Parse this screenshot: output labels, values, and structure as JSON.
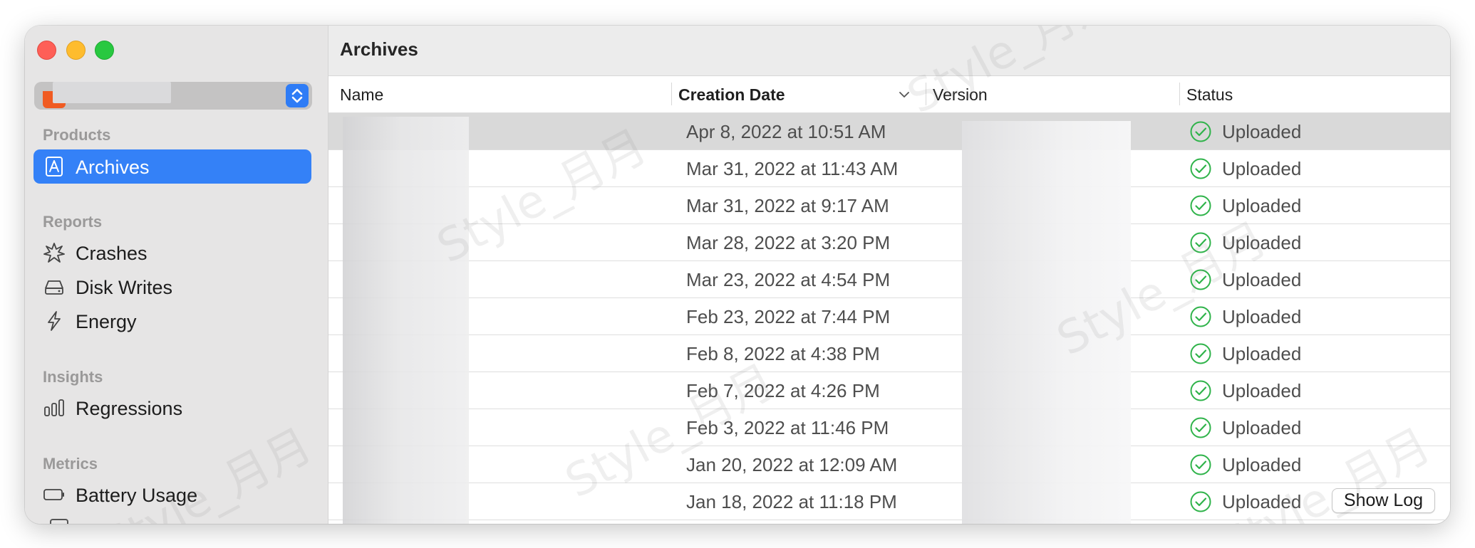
{
  "window": {
    "traffic_lights": {
      "close_color": "#fe5f57",
      "minimize_color": "#febc2e",
      "zoom_color": "#28c840"
    }
  },
  "sidebar": {
    "app_picker": {
      "icon": "app-icon",
      "accent_color": "#2e7cf6"
    },
    "sections": [
      {
        "label": "Products",
        "items": [
          {
            "label": "Archives",
            "icon": "archive-box-icon",
            "selected": true
          }
        ]
      },
      {
        "label": "Reports",
        "items": [
          {
            "label": "Crashes",
            "icon": "crash-burst-icon"
          },
          {
            "label": "Disk Writes",
            "icon": "disk-drive-icon"
          },
          {
            "label": "Energy",
            "icon": "lightning-bolt-icon"
          }
        ]
      },
      {
        "label": "Insights",
        "items": [
          {
            "label": "Regressions",
            "icon": "bar-graph-icon"
          }
        ]
      },
      {
        "label": "Metrics",
        "items": [
          {
            "label": "Battery Usage",
            "icon": "battery-icon"
          }
        ]
      }
    ],
    "selection_color": "#3481f7"
  },
  "main": {
    "title": "Archives",
    "columns": [
      {
        "label": "Name"
      },
      {
        "label": "Creation Date",
        "sorted": true,
        "sort_icon": "chevron-down-icon"
      },
      {
        "label": "Version"
      },
      {
        "label": "Status"
      }
    ],
    "rows": [
      {
        "date": "Apr 8, 2022 at 10:51 AM",
        "status": "Uploaded",
        "selected": true
      },
      {
        "date": "Mar 31, 2022 at 11:43 AM",
        "status": "Uploaded"
      },
      {
        "date": "Mar 31, 2022 at 9:17 AM",
        "status": "Uploaded"
      },
      {
        "date": "Mar 28, 2022 at 3:20 PM",
        "status": "Uploaded"
      },
      {
        "date": "Mar 23, 2022 at 4:54 PM",
        "status": "Uploaded"
      },
      {
        "date": "Feb 23, 2022 at 7:44 PM",
        "status": "Uploaded"
      },
      {
        "date": "Feb 8, 2022 at 4:38 PM",
        "status": "Uploaded"
      },
      {
        "date": "Feb 7, 2022 at 4:26 PM",
        "status": "Uploaded"
      },
      {
        "date": "Feb 3, 2022 at 11:46 PM",
        "status": "Uploaded"
      },
      {
        "date": "Jan 20, 2022 at 12:09 AM",
        "status": "Uploaded"
      },
      {
        "date": "Jan 18, 2022 at 11:18 PM",
        "status": "Uploaded",
        "action": "Show Log"
      }
    ],
    "status_icon": "checkmark-circle-icon",
    "status_color": "#2fb34a"
  },
  "watermark": {
    "text": "Style_月月"
  }
}
